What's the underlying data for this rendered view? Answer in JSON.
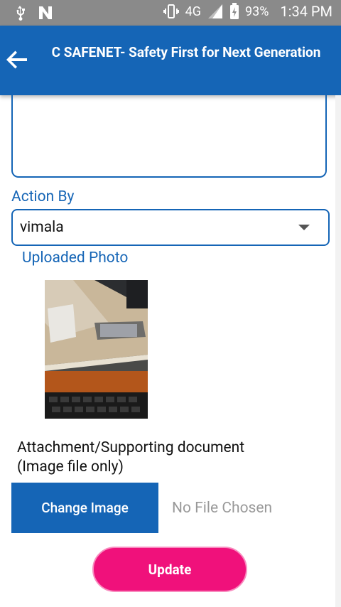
{
  "statusbar": {
    "network": "4G",
    "network_small": "4G",
    "battery": "93%",
    "time": "1:34 PM",
    "icons": [
      "usb-icon",
      "n-notification-icon",
      "vibrate-icon",
      "signal-icon",
      "data-arrows-icon",
      "battery-charging-icon"
    ]
  },
  "appbar": {
    "back_icon": "arrow-back-icon",
    "title": "C SAFENET- Safety First for Next Generation",
    "color": "#1565b6"
  },
  "form": {
    "description_value": "",
    "action_by_label": "Action By",
    "action_by_value": "vimala",
    "uploaded_photo_label": "Uploaded Photo",
    "attachment_label": "Attachment/Supporting document (Image file only)",
    "change_image_label": "Change Image",
    "no_file_text": "No File Chosen",
    "update_label": "Update"
  },
  "colors": {
    "primary": "#1565b6",
    "accent": "#f0117b",
    "statusbar": "#8a8a8a"
  }
}
